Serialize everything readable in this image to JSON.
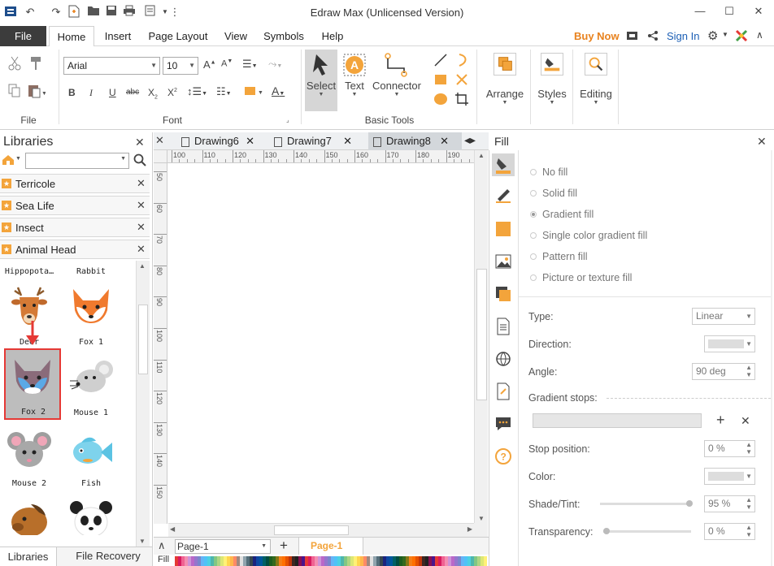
{
  "window": {
    "title": "Edraw Max (Unlicensed Version)"
  },
  "menu": {
    "file": "File",
    "tabs": [
      "Home",
      "Insert",
      "Page Layout",
      "View",
      "Symbols",
      "Help"
    ],
    "buy_now": "Buy Now",
    "sign_in": "Sign In"
  },
  "ribbon": {
    "groups": {
      "file": "File",
      "font": "Font",
      "basic_tools": "Basic Tools"
    },
    "font_name": "Arial",
    "font_size": "10",
    "select_label": "Select",
    "text_label": "Text",
    "connector_label": "Connector",
    "arrange_label": "Arrange",
    "styles_label": "Styles",
    "editing_label": "Editing"
  },
  "libraries": {
    "title": "Libraries",
    "rows": [
      "Terricole",
      "Sea Life",
      "Insect",
      "Animal Head"
    ],
    "shapes": [
      {
        "label": "Hippopota…"
      },
      {
        "label": "Rabbit"
      },
      {
        "label": "Deer"
      },
      {
        "label": "Fox 1"
      },
      {
        "label": "Fox 2"
      },
      {
        "label": "Mouse 1"
      },
      {
        "label": "Mouse 2"
      },
      {
        "label": "Fish"
      }
    ],
    "bottom_tabs": [
      "Libraries",
      "File Recovery"
    ]
  },
  "documents": {
    "tabs": [
      "Drawing6",
      "Drawing7",
      "Drawing8"
    ],
    "active": "Drawing8"
  },
  "rulers": {
    "horizontal": [
      "100",
      "110",
      "120",
      "130",
      "140",
      "150",
      "160",
      "170",
      "180",
      "190"
    ],
    "vertical": [
      "50",
      "60",
      "70",
      "80",
      "90",
      "100",
      "110",
      "120",
      "130",
      "140",
      "150"
    ]
  },
  "page_bar": {
    "page_select": "Page-1",
    "page_tab": "Page-1",
    "fill_label": "Fill"
  },
  "fill_panel": {
    "title": "Fill",
    "options": [
      "No fill",
      "Solid fill",
      "Gradient fill",
      "Single color gradient fill",
      "Pattern fill",
      "Picture or texture fill"
    ],
    "selected": "Gradient fill",
    "type_label": "Type:",
    "type_value": "Linear",
    "direction_label": "Direction:",
    "angle_label": "Angle:",
    "angle_value": "90 deg",
    "gradient_stops_label": "Gradient stops:",
    "stop_position_label": "Stop position:",
    "stop_position_value": "0 %",
    "color_label": "Color:",
    "shade_tint_label": "Shade/Tint:",
    "shade_tint_value": "95 %",
    "transparency_label": "Transparency:",
    "transparency_value": "0 %"
  },
  "colors": {
    "accent_orange": "#f3a43b",
    "file_tab_bg": "#3c3c3c",
    "highlight_red": "#e53935",
    "link_blue": "#1c5fb5"
  }
}
